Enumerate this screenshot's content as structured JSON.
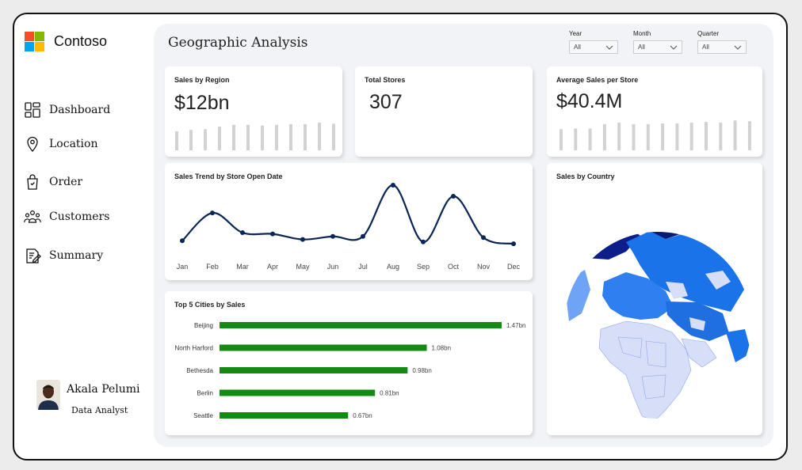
{
  "brand": {
    "name": "Contoso",
    "logo_colors": [
      "#f25022",
      "#7fba00",
      "#00a4ef",
      "#ffb900"
    ]
  },
  "nav": {
    "items": [
      {
        "label": "Dashboard",
        "icon": "dashboard-icon"
      },
      {
        "label": "Location",
        "icon": "location-pin-icon"
      },
      {
        "label": "Order",
        "icon": "shopping-bag-icon"
      },
      {
        "label": "Customers",
        "icon": "customers-icon"
      },
      {
        "label": "Summary",
        "icon": "summary-edit-icon"
      }
    ]
  },
  "profile": {
    "name": "Akala Pelumi",
    "role": "Data Analyst"
  },
  "page": {
    "title": "Geographic Analysis"
  },
  "filters": [
    {
      "label": "Year",
      "value": "All"
    },
    {
      "label": "Month",
      "value": "All"
    },
    {
      "label": "Quarter",
      "value": "All"
    }
  ],
  "cards": {
    "sales_by_region": {
      "title": "Sales by Region",
      "value": "$12bn"
    },
    "total_stores": {
      "title": "Total Stores",
      "value": "307"
    },
    "avg_sales": {
      "title": "Average Sales per Store",
      "value": "$40.4M"
    },
    "trend": {
      "title": "Sales Trend by Store Open Date"
    },
    "cities": {
      "title": "Top 5 Cities by Sales"
    },
    "country": {
      "title": "Sales by Country"
    }
  },
  "colors": {
    "accent_navy": "#0b2556",
    "bar_green": "#138a13",
    "sparkbar_gray": "#d2d2d2",
    "map_blue": "#1a73e8",
    "map_light": "#d6def8"
  },
  "chart_data": [
    {
      "type": "bar",
      "title": "",
      "note": "Sales by Region sparkbars (unlabeled)",
      "values": [
        0.52,
        0.56,
        0.58,
        0.65,
        0.7,
        0.7,
        0.68,
        0.7,
        0.72,
        0.72,
        0.76,
        0.73
      ],
      "ylim": [
        0,
        1
      ]
    },
    {
      "type": "bar",
      "title": "",
      "values": [
        0.58,
        0.6,
        0.6,
        0.72,
        0.76,
        0.72,
        0.72,
        0.74,
        0.74,
        0.76,
        0.78,
        0.76,
        0.82,
        0.8
      ],
      "ylim": [
        0,
        1
      ]
    },
    {
      "type": "line",
      "title": "Sales Trend by Store Open Date",
      "categories": [
        "Jan",
        "Feb",
        "Mar",
        "Apr",
        "May",
        "Jun",
        "Jul",
        "Aug",
        "Sep",
        "Oct",
        "Nov",
        "Dec"
      ],
      "values": [
        0.1,
        0.55,
        0.23,
        0.21,
        0.12,
        0.17,
        0.17,
        1.0,
        0.08,
        0.82,
        0.15,
        0.05
      ],
      "ylim": [
        0,
        1
      ],
      "grid": false
    },
    {
      "type": "bar",
      "orientation": "horizontal",
      "title": "Top 5 Cities by Sales",
      "categories": [
        "Beijing",
        "North Harford",
        "Bethesda",
        "Berlin",
        "Seattle"
      ],
      "values": [
        1.47,
        1.08,
        0.98,
        0.81,
        0.67
      ],
      "labels": [
        "1.47bn",
        "1.08bn",
        "0.98bn",
        "0.81bn",
        "0.67bn"
      ],
      "xlim": [
        0,
        1.5
      ]
    }
  ]
}
